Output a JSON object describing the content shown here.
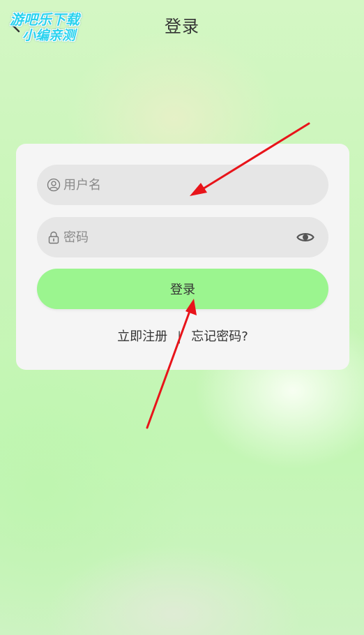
{
  "header": {
    "title": "登录",
    "back_icon": "chevron-left-icon"
  },
  "watermark": {
    "line1": "游吧乐下载",
    "line2": "小编亲测"
  },
  "form": {
    "username": {
      "placeholder": "用户名",
      "value": "",
      "icon": "user-circle-icon"
    },
    "password": {
      "placeholder": "密码",
      "value": "",
      "icon": "lock-icon",
      "toggle_icon": "eye-icon"
    },
    "login_label": "登录",
    "register_label": "立即注册",
    "separator": "|",
    "forgot_label": "忘记密码?"
  },
  "colors": {
    "login_button": "#9bf58f",
    "field_bg": "#e6e6e6",
    "card_bg": "#f5f5f5",
    "annotation_arrow": "#e8141a"
  }
}
